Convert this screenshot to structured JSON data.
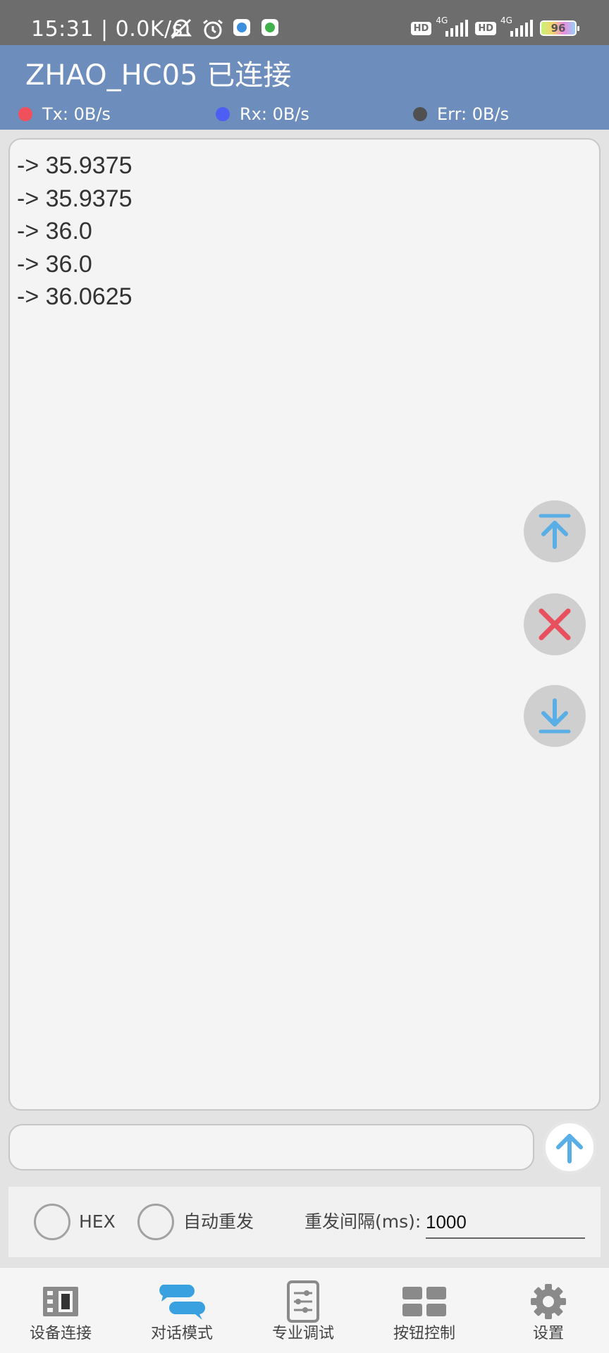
{
  "status_bar": {
    "time": "15:31",
    "speed": "0.0K/s",
    "battery": "96",
    "sim1": {
      "hd": "HD",
      "network": "4G"
    },
    "sim2": {
      "hd": "HD",
      "network": "4G"
    },
    "icons": [
      "muted-notifications-icon",
      "alarm-icon",
      "app-notification-icon",
      "wechat-icon"
    ]
  },
  "header": {
    "title": "ZHAO_HC05 已连接",
    "tx": "Tx: 0B/s",
    "rx": "Rx: 0B/s",
    "err": "Err: 0B/s",
    "colors": {
      "tx": "#f0505c",
      "rx": "#4d5ef5",
      "err": "#505050",
      "bar": "#6d8dbd"
    }
  },
  "log": {
    "lines": [
      "-> 35.9375",
      "-> 35.9375",
      "-> 36.0",
      "-> 36.0",
      "-> 36.0625"
    ]
  },
  "fab": {
    "scroll_top": "arrow-to-top-icon",
    "clear": "close-icon",
    "scroll_bottom": "arrow-to-bottom-icon",
    "accent": "#5aaee6",
    "danger": "#e8505e"
  },
  "input": {
    "value": "",
    "placeholder": ""
  },
  "options": {
    "hex_label": "HEX",
    "auto_resend_label": "自动重发",
    "interval_label": "重发间隔(ms):",
    "interval_value": "1000"
  },
  "nav": {
    "items": [
      {
        "label": "设备连接",
        "icon": "device-connect-icon"
      },
      {
        "label": "对话模式",
        "icon": "chat-icon",
        "active": true
      },
      {
        "label": "专业调试",
        "icon": "debug-sliders-icon"
      },
      {
        "label": "按钮控制",
        "icon": "button-grid-icon"
      },
      {
        "label": "设置",
        "icon": "gear-icon"
      }
    ]
  }
}
